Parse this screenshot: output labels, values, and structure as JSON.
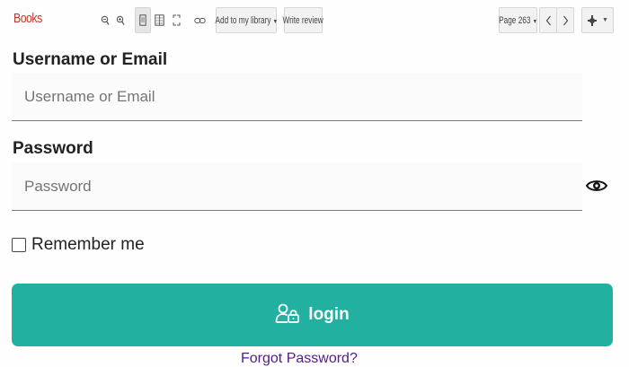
{
  "toolbar": {
    "brand": "Books",
    "add_to_library_label": "Add to my library",
    "write_review_label": "Write review",
    "page_label": "Page 263",
    "icons": [
      "zoom-out-icon",
      "zoom-in-icon",
      "single-page-icon",
      "two-page-icon",
      "fullscreen-icon",
      "link-icon",
      "dropdown-caret-icon",
      "prev-page-icon",
      "next-page-icon",
      "settings-gear-icon"
    ]
  },
  "form": {
    "username": {
      "label": "Username or Email",
      "placeholder": "Username or Email",
      "value": ""
    },
    "password": {
      "label": "Password",
      "placeholder": "Password",
      "value": ""
    },
    "remember_label": "Remember me",
    "remember_checked": false,
    "login_label": "login",
    "forgot_link": "Forgot Password?"
  },
  "colors": {
    "brand": "#c0392b",
    "login_button": "#22b0a0",
    "link": "#551a8b"
  }
}
